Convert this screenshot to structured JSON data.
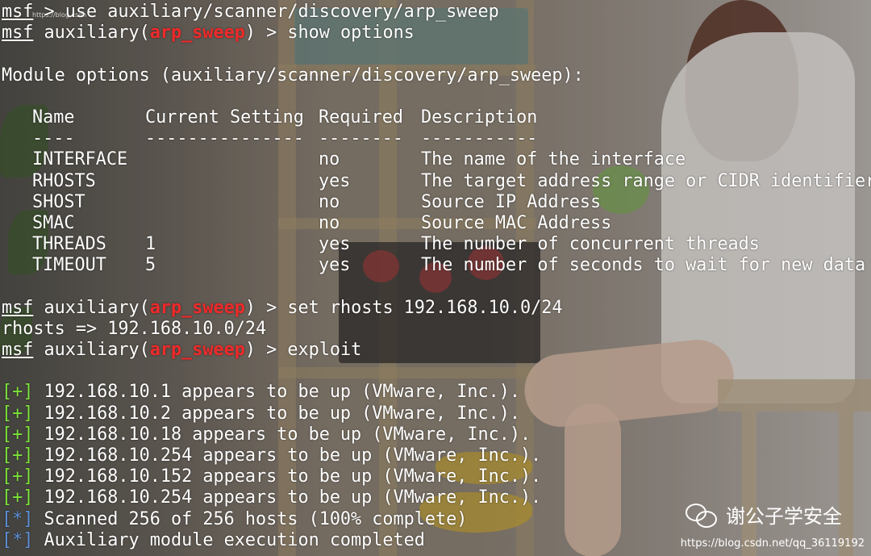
{
  "terminal": {
    "prompt_word": "msf",
    "module_label": "auxiliary",
    "module_name": "arp_sweep",
    "lines": {
      "l1_rest": " > use auxiliary/scanner/discovery/arp_sweep",
      "l2_open": " auxiliary(",
      "l2_close": ") > show options",
      "l4": "Module options (auxiliary/scanner/discovery/arp_sweep):",
      "l14_close": ") > set rhosts 192.168.10.0/24",
      "l15": "rhosts => 192.168.10.0/24",
      "l16_close": ") > exploit"
    },
    "table": {
      "headers": [
        "Name",
        "Current Setting",
        "Required",
        "Description"
      ],
      "separators": [
        "----",
        "---------------",
        "--------",
        "-----------"
      ],
      "rows": [
        [
          "INTERFACE",
          "",
          "no",
          "The name of the interface"
        ],
        [
          "RHOSTS",
          "",
          "yes",
          "The target address range or CIDR identifier"
        ],
        [
          "SHOST",
          "",
          "no",
          "Source IP Address"
        ],
        [
          "SMAC",
          "",
          "no",
          "Source MAC Address"
        ],
        [
          "THREADS",
          "1",
          "yes",
          "The number of concurrent threads"
        ],
        [
          "TIMEOUT",
          "5",
          "yes",
          "The number of seconds to wait for new data"
        ]
      ]
    },
    "results": [
      {
        "tag": "[+]",
        "text": " 192.168.10.1 appears to be up (VMware, Inc.)."
      },
      {
        "tag": "[+]",
        "text": " 192.168.10.2 appears to be up (VMware, Inc.)."
      },
      {
        "tag": "[+]",
        "text": " 192.168.10.18 appears to be up (VMware, Inc.)."
      },
      {
        "tag": "[+]",
        "text": " 192.168.10.254 appears to be up (VMware, Inc.)."
      },
      {
        "tag": "[+]",
        "text": " 192.168.10.152 appears to be up (VMware, Inc.)."
      },
      {
        "tag": "[+]",
        "text": " 192.168.10.254 appears to be up (VMware, Inc.)."
      }
    ],
    "status": [
      {
        "tag": "[*]",
        "text": " Scanned 256 of 256 hosts (100% complete)"
      },
      {
        "tag": "[*]",
        "text": " Auxiliary module execution completed"
      }
    ],
    "colors": {
      "text": "#ffffff",
      "module_name": "#f02a2a",
      "success_tag": "#7ce33a",
      "info_tag": "#5c8fd6"
    }
  },
  "watermark": {
    "icon": "wechat-icon",
    "account": "谢公子学安全",
    "url": "https://blog.csdn.net/qq_36119192",
    "tiny_text": "https://blog.csdn"
  }
}
